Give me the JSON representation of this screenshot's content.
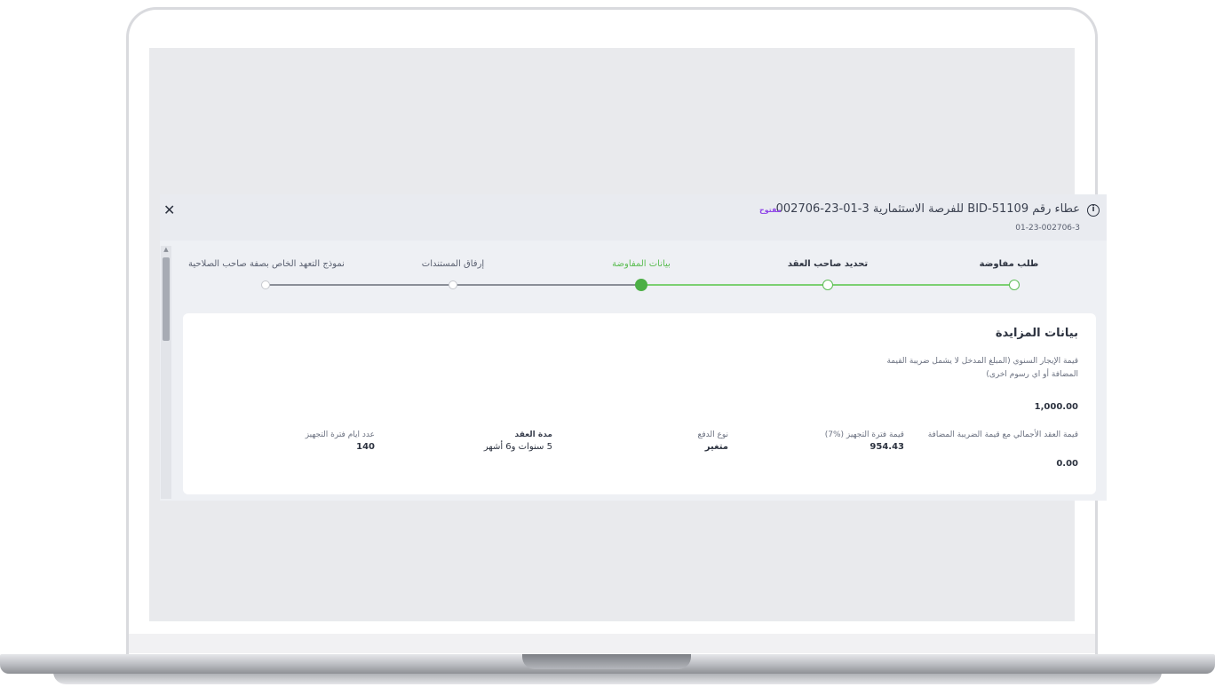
{
  "header": {
    "title": "عطاء رقم BID-51109 للفرصة الاستثمارية 3-01-23-002706",
    "subtitle": "01-23-002706-3",
    "status_badge": "مفتوح",
    "info_icon": "info-circle-icon",
    "close_icon": "close-x-icon",
    "close_glyph": "✕"
  },
  "stepper": {
    "steps": [
      {
        "label": "طلب مفاوضة",
        "state": "done"
      },
      {
        "label": "تحديد صاحب العقد",
        "state": "done"
      },
      {
        "label": "بيانات المفاوضة",
        "state": "current"
      },
      {
        "label": "إرفاق المستندات",
        "state": "pending"
      },
      {
        "label": "نموذج التعهد الخاص بصفة صاحب الصلاحية",
        "state": "pending"
      }
    ]
  },
  "bid_details": {
    "title": "بيانات المزايدة",
    "annual_rent": {
      "label": "قيمة الإيجار السنوي (المبلغ المدخل لا يشمل ضريبة القيمة المضافة أو اي رسوم اخرى)",
      "value": "1,000.00"
    },
    "fields": [
      {
        "label": "قيمة العقد الأجمالي مع قيمة الضريبة المضافة",
        "value": "0.00"
      },
      {
        "label": "قيمة فترة التجهيز (%7)",
        "value": "954.43"
      },
      {
        "label": "نوع الدفع",
        "value": "متغير"
      },
      {
        "label": "مدة العقد",
        "value": "5 سنوات و6 أشهر"
      },
      {
        "label": "عدد ايام فترة التجهيز",
        "value": "140"
      }
    ]
  },
  "colors": {
    "accent_green": "#4caf45",
    "badge_purple": "#8e44e8",
    "text_dark": "#2d3340"
  }
}
